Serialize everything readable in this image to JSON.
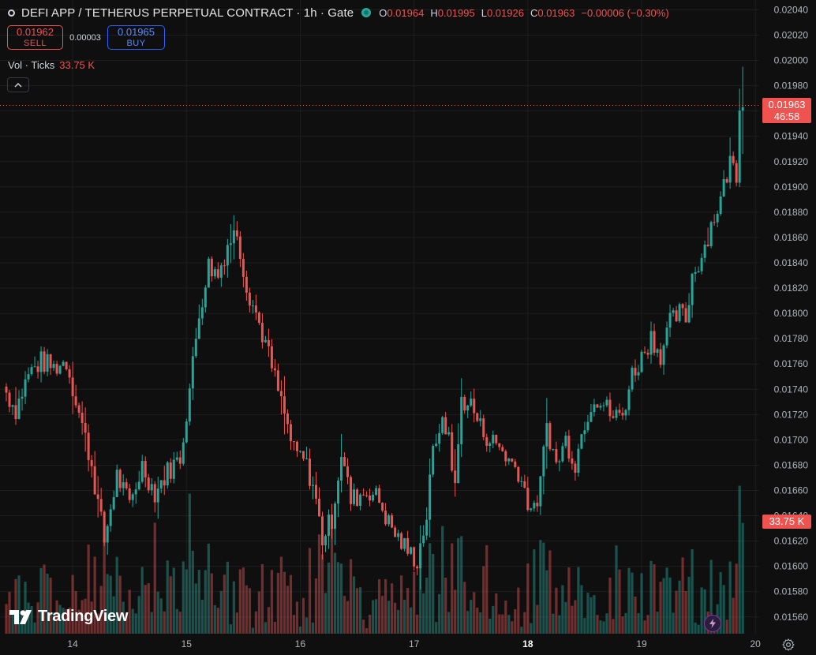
{
  "header": {
    "title": "DEFI APP / TETHERUS PERPETUAL CONTRACT · 1h · Gate",
    "ohlc": [
      {
        "k": "O",
        "v": "0.01964"
      },
      {
        "k": "H",
        "v": "0.01995"
      },
      {
        "k": "L",
        "v": "0.01926"
      },
      {
        "k": "C",
        "v": "0.01963"
      }
    ],
    "change": "−0.00006 (−0.30%)"
  },
  "trade": {
    "sell_price": "0.01962",
    "sell_label": "SELL",
    "spread": "0.00003",
    "buy_price": "0.01965",
    "buy_label": "BUY"
  },
  "volume_legend": {
    "label": "Vol · Ticks",
    "value": "33.75 K"
  },
  "price_tag": {
    "price": "0.01963",
    "countdown": "46:58"
  },
  "volume_tag": "33.75 K",
  "logo_text": "TradingView",
  "colors": {
    "up": "#26a69a",
    "down": "#ef5350",
    "background": "#0f0f0f",
    "grid": "#1e1e1e"
  },
  "chart_data": {
    "type": "candlestick",
    "timeframe": "1h",
    "y_ticks": [
      "0.02040",
      "0.02020",
      "0.02000",
      "0.01980",
      "0.01960",
      "0.01940",
      "0.01920",
      "0.01900",
      "0.01880",
      "0.01860",
      "0.01840",
      "0.01820",
      "0.01800",
      "0.01780",
      "0.01760",
      "0.01740",
      "0.01720",
      "0.01700",
      "0.01680",
      "0.01660",
      "0.01640",
      "0.01620",
      "0.01600",
      "0.01580",
      "0.01560"
    ],
    "ylim": [
      0.01553,
      0.02044
    ],
    "x_ticks": [
      {
        "label": "14",
        "bold": false
      },
      {
        "label": "15",
        "bold": false
      },
      {
        "label": "16",
        "bold": false
      },
      {
        "label": "17",
        "bold": false
      },
      {
        "label": "18",
        "bold": true
      },
      {
        "label": "19",
        "bold": false
      },
      {
        "label": "20",
        "bold": false
      }
    ],
    "anchors": [
      {
        "t": 0,
        "c": 0.01742,
        "h": 0.01763,
        "l": 0.01706
      },
      {
        "t": 4,
        "c": 0.01724,
        "h": 0.0175,
        "l": 0.01705
      },
      {
        "t": 8,
        "c": 0.01752,
        "h": 0.01775,
        "l": 0.01735
      },
      {
        "t": 12,
        "c": 0.01762,
        "h": 0.01778,
        "l": 0.01745
      },
      {
        "t": 16,
        "c": 0.01757,
        "h": 0.0177,
        "l": 0.01744
      },
      {
        "t": 20,
        "c": 0.01762,
        "h": 0.01768,
        "l": 0.01748
      },
      {
        "t": 24,
        "c": 0.01722,
        "h": 0.01755,
        "l": 0.01712
      },
      {
        "t": 28,
        "c": 0.0168,
        "h": 0.0172,
        "l": 0.0166
      },
      {
        "t": 32,
        "c": 0.0162,
        "h": 0.01665,
        "l": 0.01613
      },
      {
        "t": 36,
        "c": 0.01672,
        "h": 0.01685,
        "l": 0.0165
      },
      {
        "t": 40,
        "c": 0.01648,
        "h": 0.01672,
        "l": 0.0164
      },
      {
        "t": 44,
        "c": 0.0168,
        "h": 0.01688,
        "l": 0.0165
      },
      {
        "t": 48,
        "c": 0.01658,
        "h": 0.01672,
        "l": 0.01648
      },
      {
        "t": 52,
        "c": 0.01675,
        "h": 0.01688,
        "l": 0.01646
      },
      {
        "t": 56,
        "c": 0.01686,
        "h": 0.01692,
        "l": 0.01668
      },
      {
        "t": 59,
        "c": 0.0174,
        "h": 0.0175,
        "l": 0.01726
      },
      {
        "t": 62,
        "c": 0.018,
        "h": 0.01815,
        "l": 0.0176
      },
      {
        "t": 65,
        "c": 0.01838,
        "h": 0.01846,
        "l": 0.01815
      },
      {
        "t": 68,
        "c": 0.0183,
        "h": 0.0187,
        "l": 0.01818
      },
      {
        "t": 71,
        "c": 0.01855,
        "h": 0.01867,
        "l": 0.01835
      },
      {
        "t": 74,
        "c": 0.01865,
        "h": 0.019,
        "l": 0.01838
      },
      {
        "t": 77,
        "c": 0.01822,
        "h": 0.01855,
        "l": 0.018
      },
      {
        "t": 80,
        "c": 0.018,
        "h": 0.01825,
        "l": 0.01795
      },
      {
        "t": 83,
        "c": 0.01776,
        "h": 0.0179,
        "l": 0.0176
      },
      {
        "t": 86,
        "c": 0.01748,
        "h": 0.01765,
        "l": 0.0173
      },
      {
        "t": 89,
        "c": 0.0172,
        "h": 0.01752,
        "l": 0.017
      },
      {
        "t": 92,
        "c": 0.0169,
        "h": 0.01725,
        "l": 0.0168
      },
      {
        "t": 95,
        "c": 0.01685,
        "h": 0.01697,
        "l": 0.01676
      },
      {
        "t": 98,
        "c": 0.01665,
        "h": 0.01685,
        "l": 0.0165
      },
      {
        "t": 101,
        "c": 0.01622,
        "h": 0.01665,
        "l": 0.01608
      },
      {
        "t": 104,
        "c": 0.01638,
        "h": 0.01662,
        "l": 0.01617
      },
      {
        "t": 107,
        "c": 0.0169,
        "h": 0.017,
        "l": 0.0164
      },
      {
        "t": 110,
        "c": 0.01652,
        "h": 0.01678,
        "l": 0.0164
      },
      {
        "t": 113,
        "c": 0.01657,
        "h": 0.01668,
        "l": 0.01646
      },
      {
        "t": 116,
        "c": 0.0166,
        "h": 0.01672,
        "l": 0.01652
      },
      {
        "t": 119,
        "c": 0.01652,
        "h": 0.01664,
        "l": 0.01645
      },
      {
        "t": 122,
        "c": 0.01634,
        "h": 0.0165,
        "l": 0.01628
      },
      {
        "t": 125,
        "c": 0.01622,
        "h": 0.01635,
        "l": 0.01617
      },
      {
        "t": 128,
        "c": 0.01612,
        "h": 0.01622,
        "l": 0.01605
      },
      {
        "t": 131,
        "c": 0.01605,
        "h": 0.01614,
        "l": 0.01595
      },
      {
        "t": 134,
        "c": 0.0164,
        "h": 0.01655,
        "l": 0.01598
      },
      {
        "t": 136,
        "c": 0.0169,
        "h": 0.017,
        "l": 0.01635
      },
      {
        "t": 138,
        "c": 0.01712,
        "h": 0.0172,
        "l": 0.01688
      },
      {
        "t": 141,
        "c": 0.01705,
        "h": 0.01725,
        "l": 0.01697
      },
      {
        "t": 143,
        "c": 0.0166,
        "h": 0.01712,
        "l": 0.01655
      },
      {
        "t": 145,
        "c": 0.01732,
        "h": 0.0174,
        "l": 0.0166
      },
      {
        "t": 148,
        "c": 0.01728,
        "h": 0.01736,
        "l": 0.01714
      },
      {
        "t": 151,
        "c": 0.0171,
        "h": 0.0173,
        "l": 0.017
      },
      {
        "t": 154,
        "c": 0.017,
        "h": 0.01716,
        "l": 0.01694
      },
      {
        "t": 157,
        "c": 0.01695,
        "h": 0.01705,
        "l": 0.01688
      },
      {
        "t": 160,
        "c": 0.01684,
        "h": 0.01694,
        "l": 0.01678
      },
      {
        "t": 163,
        "c": 0.01676,
        "h": 0.01682,
        "l": 0.0167
      },
      {
        "t": 166,
        "c": 0.01652,
        "h": 0.0167,
        "l": 0.01628
      },
      {
        "t": 168,
        "c": 0.01642,
        "h": 0.0166,
        "l": 0.01632
      },
      {
        "t": 170,
        "c": 0.01665,
        "h": 0.0168,
        "l": 0.0164
      },
      {
        "t": 172,
        "c": 0.01712,
        "h": 0.0172,
        "l": 0.0166
      },
      {
        "t": 175,
        "c": 0.0168,
        "h": 0.01718,
        "l": 0.01674
      },
      {
        "t": 178,
        "c": 0.017,
        "h": 0.01712,
        "l": 0.0169
      },
      {
        "t": 181,
        "c": 0.01682,
        "h": 0.01708,
        "l": 0.01676
      },
      {
        "t": 184,
        "c": 0.01715,
        "h": 0.01735,
        "l": 0.017
      },
      {
        "t": 187,
        "c": 0.01735,
        "h": 0.01746,
        "l": 0.01715
      },
      {
        "t": 190,
        "c": 0.01728,
        "h": 0.0174,
        "l": 0.01716
      },
      {
        "t": 193,
        "c": 0.01718,
        "h": 0.01728,
        "l": 0.017
      },
      {
        "t": 196,
        "c": 0.0172,
        "h": 0.01738,
        "l": 0.01712
      },
      {
        "t": 199,
        "c": 0.01752,
        "h": 0.0176,
        "l": 0.01718
      },
      {
        "t": 202,
        "c": 0.01765,
        "h": 0.01772,
        "l": 0.01748
      },
      {
        "t": 205,
        "c": 0.01782,
        "h": 0.01795,
        "l": 0.0176
      },
      {
        "t": 208,
        "c": 0.01768,
        "h": 0.0179,
        "l": 0.0176
      },
      {
        "t": 211,
        "c": 0.01792,
        "h": 0.018,
        "l": 0.0177
      },
      {
        "t": 214,
        "c": 0.018,
        "h": 0.01815,
        "l": 0.01788
      },
      {
        "t": 216,
        "c": 0.01795,
        "h": 0.01812,
        "l": 0.01785
      },
      {
        "t": 218,
        "c": 0.0183,
        "h": 0.01836,
        "l": 0.01785
      },
      {
        "t": 221,
        "c": 0.01846,
        "h": 0.01855,
        "l": 0.0183
      },
      {
        "t": 224,
        "c": 0.0187,
        "h": 0.0188,
        "l": 0.01842
      },
      {
        "t": 227,
        "c": 0.0189,
        "h": 0.01898,
        "l": 0.0187
      },
      {
        "t": 230,
        "c": 0.0192,
        "h": 0.0193,
        "l": 0.01885
      },
      {
        "t": 232,
        "c": 0.01912,
        "h": 0.01925,
        "l": 0.019
      },
      {
        "t": 233,
        "c": 0.01964,
        "h": 0.01966,
        "l": 0.01908
      },
      {
        "t": 234,
        "c": 0.01963,
        "h": 0.01995,
        "l": 0.01926
      }
    ],
    "volume": {
      "axis_max": 0.00042,
      "last_bar": 33750
    }
  }
}
